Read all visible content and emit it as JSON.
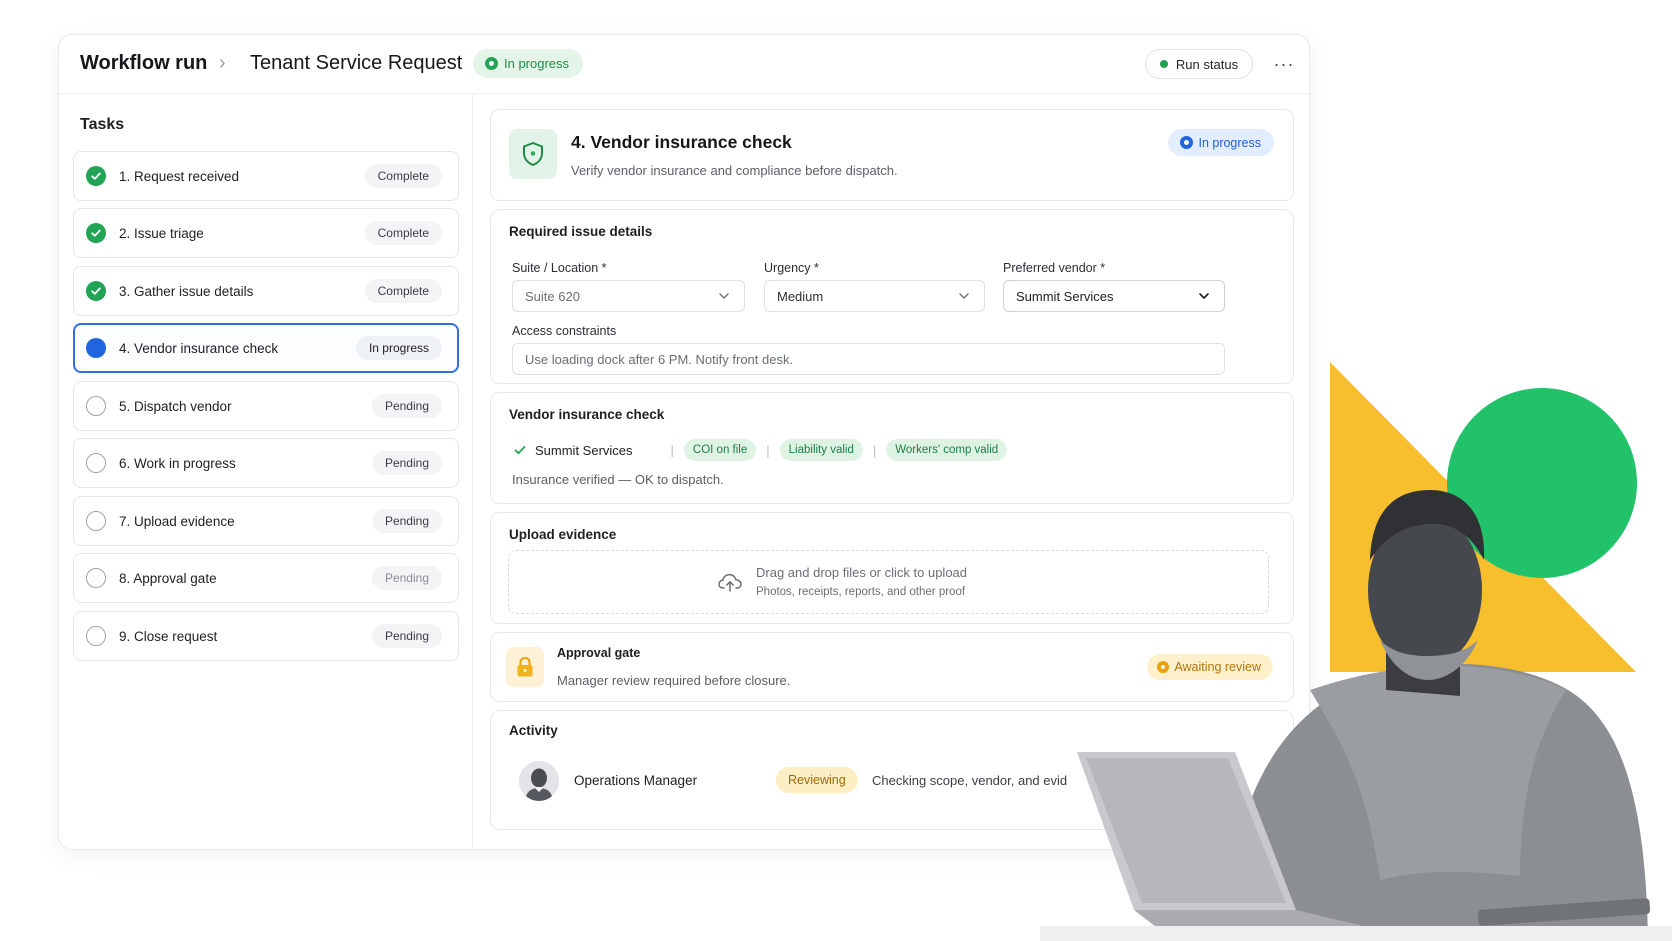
{
  "header": {
    "breadcrumb_root": "Workflow run",
    "breadcrumb_separator": "›",
    "page_title": "Tenant Service Request",
    "status_label": "In progress",
    "run_status_label": "Run status",
    "more_label": "···"
  },
  "sidebar": {
    "title": "Tasks",
    "tasks": [
      {
        "label": "1. Request received",
        "status": "Complete"
      },
      {
        "label": "2. Issue triage",
        "status": "Complete"
      },
      {
        "label": "3. Gather issue details",
        "status": "Complete"
      },
      {
        "label": "4. Vendor insurance check",
        "status": "In progress"
      },
      {
        "label": "5. Dispatch vendor",
        "status": "Pending"
      },
      {
        "label": "6. Work in progress",
        "status": "Pending"
      },
      {
        "label": "7. Upload evidence",
        "status": "Pending"
      },
      {
        "label": "8. Approval gate",
        "status": "Pending"
      },
      {
        "label": "9. Close request",
        "status": "Pending"
      }
    ]
  },
  "step": {
    "title": "4. Vendor insurance check",
    "subtitle": "Verify vendor insurance and compliance before dispatch.",
    "status_label": "In progress"
  },
  "required": {
    "title": "Required issue details",
    "suite_label": "Suite / Location *",
    "suite_value": "Suite 620",
    "urgency_label": "Urgency *",
    "urgency_value": "Medium",
    "vendor_label": "Preferred vendor *",
    "vendor_value": "Summit Services",
    "access_label": "Access constraints",
    "access_value": "Use loading dock after 6 PM. Notify front desk."
  },
  "insurance": {
    "title": "Vendor insurance check",
    "vendor": "Summit Services",
    "separator": "|",
    "tags": [
      "COI on file",
      "Liability valid",
      "Workers' comp valid"
    ],
    "note": "Insurance verified — OK to dispatch."
  },
  "upload": {
    "title": "Upload evidence",
    "main_text": "Drag and drop files or click to upload",
    "sub_text": "Photos, receipts, reports, and other proof"
  },
  "approval": {
    "title": "Approval gate",
    "subtitle": "Manager review required before closure.",
    "status_label": "Awaiting review"
  },
  "activity": {
    "title": "Activity",
    "name": "Operations Manager",
    "tag": "Reviewing",
    "text": "Checking scope, vendor, and evid"
  },
  "colors": {
    "accent_blue": "#2064e0",
    "success_green": "#21a455",
    "warning_amber": "#e8a20c",
    "deco_yellow": "#f7be2e",
    "deco_green": "#22c26a"
  },
  "icons": {
    "complete": "check-circle-icon",
    "current": "dot-circle-icon",
    "pending": "empty-circle-icon",
    "step": "shield-icon",
    "upload": "cloud-upload-icon",
    "approval": "lock-icon"
  }
}
